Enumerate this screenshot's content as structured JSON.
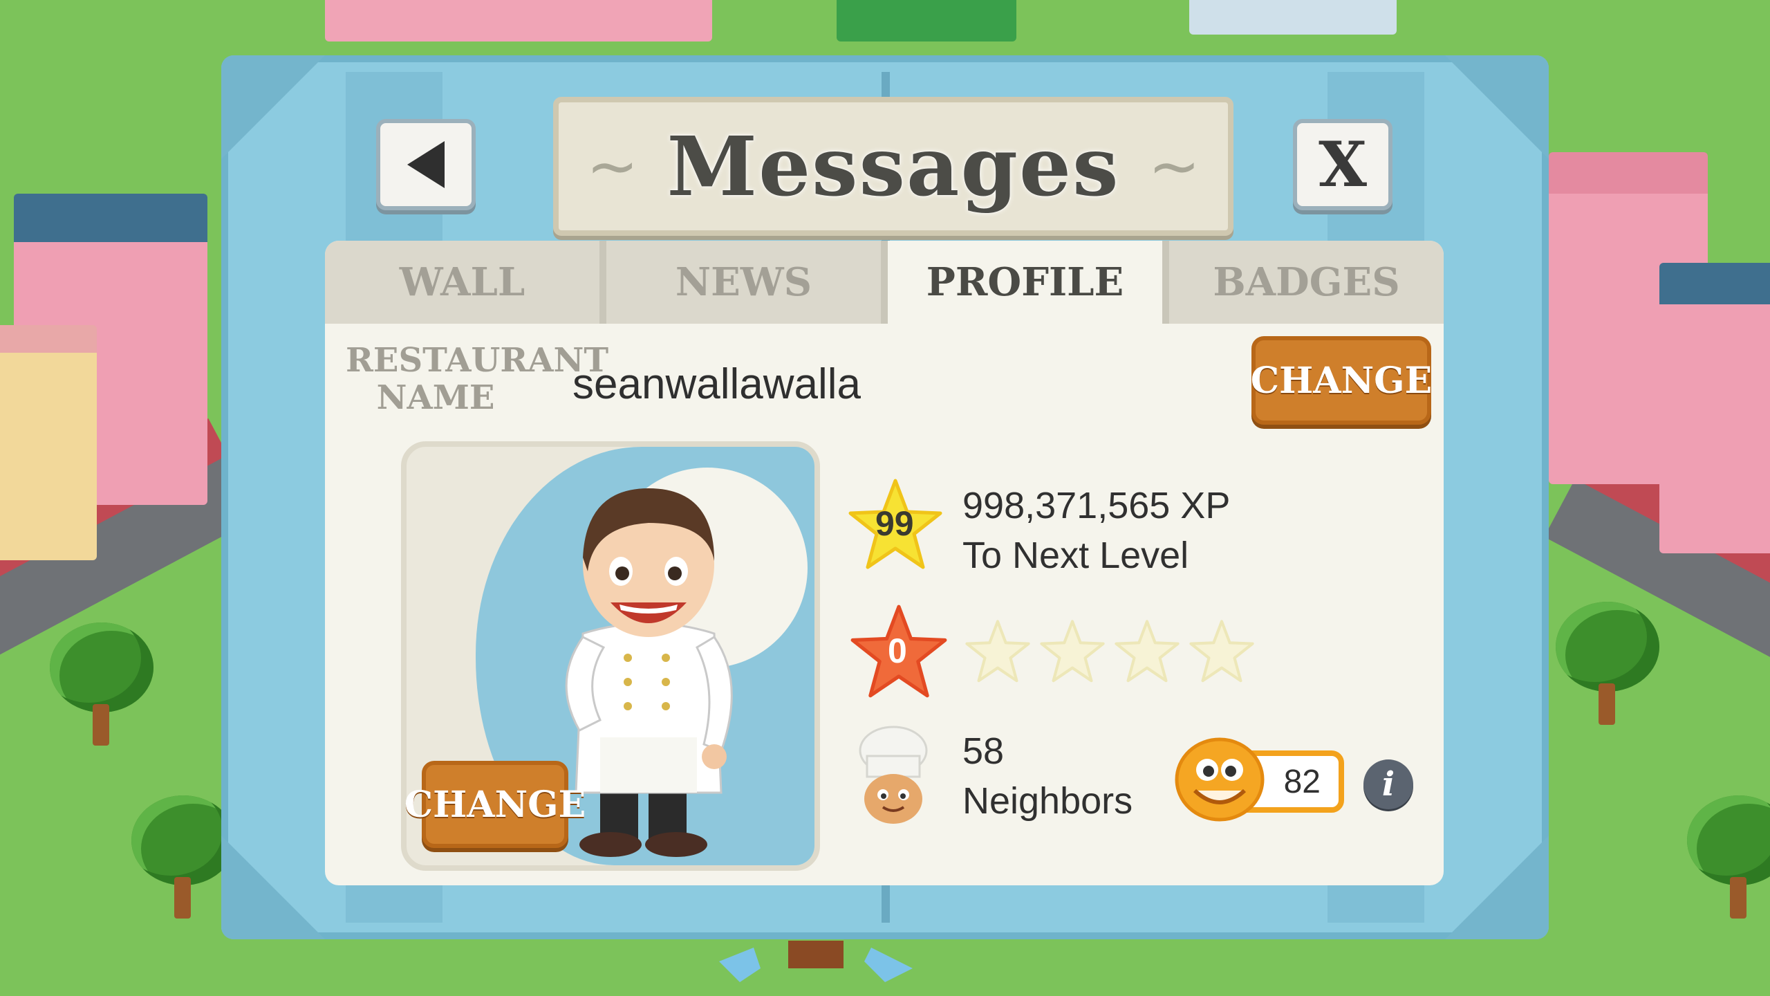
{
  "dialog": {
    "title": "Messages",
    "back_icon": "back-arrow-icon",
    "close_label": "X"
  },
  "tabs": [
    {
      "label": "WALL",
      "active": false
    },
    {
      "label": "NEWS",
      "active": false
    },
    {
      "label": "PROFILE",
      "active": true
    },
    {
      "label": "BADGES",
      "active": false
    }
  ],
  "profile": {
    "restaurant_name_label": "RESTAURANT NAME",
    "restaurant_name": "seanwallawalla",
    "change_name_label": "CHANGE",
    "change_avatar_label": "CHANGE",
    "level": "99",
    "xp_amount": "998,371,565 XP",
    "xp_caption": "To Next Level",
    "rating": "0",
    "rating_stars_filled": 0,
    "rating_stars_total": 4,
    "neighbors_count": "58",
    "neighbors_label": "Neighbors",
    "coins": "82"
  },
  "colors": {
    "frame": "#8ccbe0",
    "panel": "#f5f4ec",
    "change_button": "#cf7f2b",
    "xp_star": "#f7e233",
    "rating_star": "#f06a3a",
    "coin_border": "#f3a21c"
  }
}
